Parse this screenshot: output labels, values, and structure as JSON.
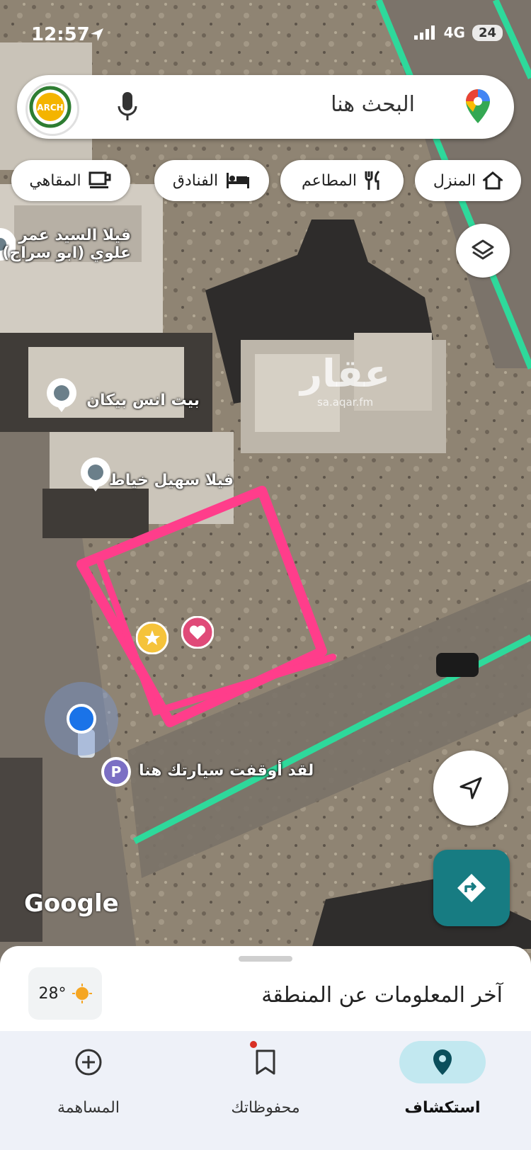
{
  "status_bar": {
    "time": "12:57",
    "network": "4G",
    "battery": "24"
  },
  "search": {
    "placeholder": "البحث هنا",
    "avatar_text": "ARCH"
  },
  "chips": [
    {
      "label": "المنزل",
      "icon": "home-icon"
    },
    {
      "label": "المطاعم",
      "icon": "restaurant-icon"
    },
    {
      "label": "الفنادق",
      "icon": "hotel-icon"
    },
    {
      "label": "المقاهي",
      "icon": "cafe-icon"
    }
  ],
  "map": {
    "places": [
      {
        "line1": "فيلا السيد عمر",
        "line2": "علوي (ابو سراج)"
      },
      {
        "line1": "بيت انس بيكان"
      },
      {
        "line1": "فيلا سهيل خياط"
      }
    ],
    "parking_label": "لقد أوقفت سيارتك هنا",
    "parking_icon_text": "P",
    "watermark": {
      "big": "عقار",
      "small": "sa.aqar.fm"
    },
    "attribution": "Google",
    "colors": {
      "boundary": "#ff3d8b",
      "road_line": "#2ed99b",
      "location": "#1a73e8",
      "direction_button": "#177c82"
    }
  },
  "sheet": {
    "title": "آخر المعلومات عن المنطقة",
    "temperature": "28°"
  },
  "bottom_nav": [
    {
      "label": "استكشاف",
      "icon": "location-pin-icon",
      "active": true
    },
    {
      "label": "محفوظاتك",
      "icon": "bookmark-icon",
      "active": false
    },
    {
      "label": "المساهمة",
      "icon": "plus-circle-icon",
      "active": false
    }
  ]
}
